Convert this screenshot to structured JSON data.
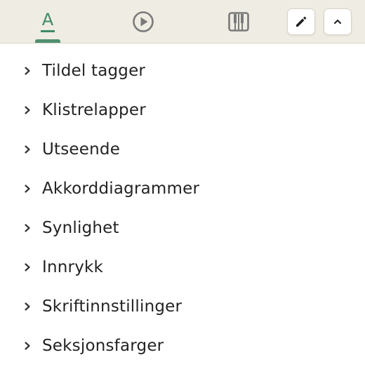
{
  "toolbar": {
    "tabs": [
      {
        "name": "text",
        "icon": "letter-a-icon",
        "label": "A",
        "active": true
      },
      {
        "name": "play",
        "icon": "play-circle-icon",
        "active": false
      },
      {
        "name": "piano",
        "icon": "piano-keys-icon",
        "active": false
      }
    ],
    "edit_button": {
      "icon": "pencil-icon"
    },
    "collapse_button": {
      "icon": "chevron-up-icon"
    }
  },
  "sections": [
    {
      "label": "Tildel tagger"
    },
    {
      "label": "Klistrelapper"
    },
    {
      "label": "Utseende"
    },
    {
      "label": "Akkorddiagrammer"
    },
    {
      "label": "Synlighet"
    },
    {
      "label": "Innrykk"
    },
    {
      "label": "Skriftinnstillinger"
    },
    {
      "label": "Seksjonsfarger"
    }
  ],
  "colors": {
    "accent": "#4f8f6f",
    "toolbar_bg": "#efece3",
    "text": "#232323",
    "icon_gray": "#7a7a7a"
  }
}
